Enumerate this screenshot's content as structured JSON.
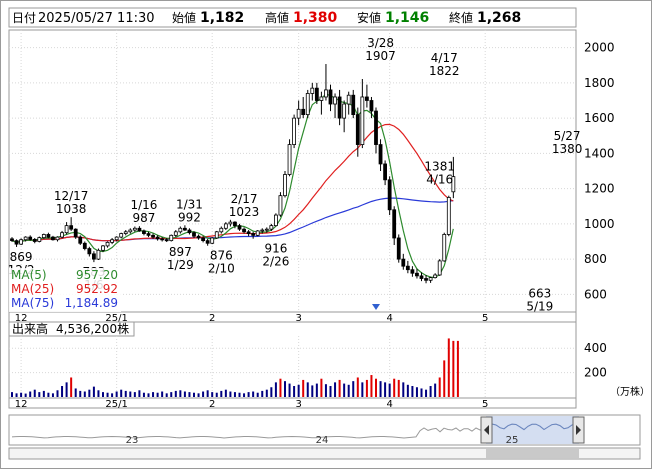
{
  "header": {
    "date_label": "日付",
    "date_value": "2025/05/27 11:30",
    "open_label": "始値",
    "open_value": "1,182",
    "high_label": "高値",
    "high_value": "1,380",
    "low_label": "安値",
    "low_value": "1,146",
    "close_label": "終値",
    "close_value": "1,268"
  },
  "colors": {
    "up": "#000080",
    "down": "#000000",
    "ma5": "#2e8b2e",
    "ma25": "#e02020",
    "ma75": "#2a3ad8",
    "high_value_text": "#e00000",
    "low_value_text": "#008000",
    "volume_normal": "#000080",
    "volume_high": "#e00000",
    "navigator_fill": "#b7c8e8"
  },
  "legend": {
    "ma5_label": "MA(5)",
    "ma5_value": "957.20",
    "ma25_label": "MA(25)",
    "ma25_value": "952.92",
    "ma75_label": "MA(75)",
    "ma75_value": "1,184.89"
  },
  "volume_panel": {
    "title": "出来高",
    "value": "4,536,200株",
    "unit": "（万株）"
  },
  "navigator": {
    "year_labels": [
      "23",
      "24",
      "25"
    ]
  },
  "chart_data": [
    {
      "type": "candlestick",
      "title": "",
      "ylim": [
        500,
        2100
      ],
      "y_ticks": [
        600,
        800,
        1000,
        1200,
        1400,
        1600,
        1800,
        2000
      ],
      "month_labels": [
        {
          "label": "12",
          "day": 2
        },
        {
          "label": "25/1",
          "day": 23
        },
        {
          "label": "2",
          "day": 44
        },
        {
          "label": "3",
          "day": 63
        },
        {
          "label": "4",
          "day": 83
        },
        {
          "label": "5",
          "day": 104
        }
      ],
      "annotations": [
        {
          "text": "869",
          "sub": "12/2",
          "day": 2,
          "value": 869,
          "pos": "below"
        },
        {
          "text": "12/17",
          "sub": "1038",
          "day": 13,
          "value": 1038,
          "pos": "above"
        },
        {
          "text": "783",
          "sub": "1/6",
          "day": 18,
          "value": 783,
          "pos": "below"
        },
        {
          "text": "1/16",
          "sub": "987",
          "day": 29,
          "value": 987,
          "pos": "above"
        },
        {
          "text": "897",
          "sub": "1/29",
          "day": 37,
          "value": 897,
          "pos": "below"
        },
        {
          "text": "1/31",
          "sub": "992",
          "day": 39,
          "value": 992,
          "pos": "above"
        },
        {
          "text": "876",
          "sub": "2/10",
          "day": 46,
          "value": 876,
          "pos": "below"
        },
        {
          "text": "2/17",
          "sub": "1023",
          "day": 51,
          "value": 1023,
          "pos": "above"
        },
        {
          "text": "916",
          "sub": "2/26",
          "day": 58,
          "value": 916,
          "pos": "below"
        },
        {
          "text": "3/28",
          "sub": "1907",
          "day": 81,
          "value": 1907,
          "pos": "above"
        },
        {
          "text": "4/17",
          "sub": "1822",
          "day": 95,
          "value": 1822,
          "pos": "above"
        },
        {
          "text": "1381",
          "sub": "4/16",
          "day": 94,
          "value": 1381,
          "pos": "below"
        },
        {
          "text": "663",
          "sub": "5/19",
          "day": 116,
          "value": 663,
          "pos": "below"
        },
        {
          "text": "5/27",
          "sub": "1380",
          "day": 122,
          "value": 1380,
          "pos": "above"
        }
      ],
      "candles": [
        [
          915,
          925,
          898,
          905
        ],
        [
          905,
          912,
          869,
          885
        ],
        [
          885,
          918,
          880,
          910
        ],
        [
          910,
          930,
          900,
          925
        ],
        [
          925,
          935,
          905,
          912
        ],
        [
          912,
          920,
          890,
          900
        ],
        [
          900,
          928,
          895,
          922
        ],
        [
          922,
          945,
          915,
          940
        ],
        [
          940,
          950,
          918,
          925
        ],
        [
          925,
          932,
          905,
          910
        ],
        [
          910,
          930,
          900,
          925
        ],
        [
          925,
          960,
          918,
          950
        ],
        [
          950,
          1010,
          940,
          990
        ],
        [
          990,
          1038,
          960,
          970
        ],
        [
          970,
          975,
          915,
          925
        ],
        [
          925,
          935,
          880,
          890
        ],
        [
          890,
          900,
          850,
          860
        ],
        [
          860,
          870,
          815,
          830
        ],
        [
          830,
          845,
          783,
          800
        ],
        [
          800,
          860,
          795,
          850
        ],
        [
          850,
          880,
          840,
          875
        ],
        [
          875,
          900,
          865,
          895
        ],
        [
          895,
          920,
          885,
          910
        ],
        [
          910,
          930,
          900,
          925
        ],
        [
          925,
          950,
          918,
          945
        ],
        [
          945,
          965,
          935,
          955
        ],
        [
          955,
          975,
          945,
          965
        ],
        [
          965,
          985,
          955,
          975
        ],
        [
          975,
          987,
          955,
          960
        ],
        [
          960,
          968,
          935,
          945
        ],
        [
          945,
          955,
          925,
          935
        ],
        [
          935,
          945,
          915,
          925
        ],
        [
          925,
          935,
          905,
          915
        ],
        [
          915,
          925,
          900,
          910
        ],
        [
          910,
          920,
          897,
          905
        ],
        [
          905,
          940,
          900,
          935
        ],
        [
          935,
          965,
          925,
          955
        ],
        [
          955,
          985,
          945,
          975
        ],
        [
          975,
          992,
          960,
          965
        ],
        [
          965,
          975,
          940,
          950
        ],
        [
          950,
          958,
          920,
          930
        ],
        [
          930,
          940,
          910,
          920
        ],
        [
          920,
          930,
          895,
          905
        ],
        [
          905,
          915,
          876,
          890
        ],
        [
          890,
          925,
          885,
          920
        ],
        [
          920,
          960,
          915,
          955
        ],
        [
          955,
          985,
          945,
          975
        ],
        [
          975,
          1010,
          965,
          1000
        ],
        [
          1000,
          1023,
          985,
          1010
        ],
        [
          1010,
          1015,
          975,
          990
        ],
        [
          990,
          1000,
          960,
          970
        ],
        [
          970,
          980,
          945,
          955
        ],
        [
          955,
          965,
          930,
          945
        ],
        [
          945,
          955,
          916,
          935
        ],
        [
          935,
          965,
          930,
          960
        ],
        [
          960,
          975,
          945,
          965
        ],
        [
          965,
          980,
          950,
          970
        ],
        [
          970,
          1000,
          960,
          990
        ],
        [
          990,
          1060,
          985,
          1050
        ],
        [
          1050,
          1180,
          1040,
          1160
        ],
        [
          1160,
          1300,
          1150,
          1280
        ],
        [
          1280,
          1480,
          1270,
          1450
        ],
        [
          1450,
          1620,
          1430,
          1600
        ],
        [
          1600,
          1700,
          1560,
          1650
        ],
        [
          1650,
          1720,
          1600,
          1620
        ],
        [
          1620,
          1760,
          1600,
          1740
        ],
        [
          1740,
          1800,
          1700,
          1770
        ],
        [
          1770,
          1800,
          1680,
          1700
        ],
        [
          1700,
          1750,
          1620,
          1720
        ],
        [
          1720,
          1907,
          1700,
          1760
        ],
        [
          1760,
          1790,
          1640,
          1680
        ],
        [
          1680,
          1740,
          1600,
          1720
        ],
        [
          1720,
          1760,
          1560,
          1600
        ],
        [
          1600,
          1700,
          1520,
          1680
        ],
        [
          1680,
          1750,
          1620,
          1730
        ],
        [
          1730,
          1760,
          1600,
          1620
        ],
        [
          1620,
          1660,
          1381,
          1450
        ],
        [
          1450,
          1822,
          1430,
          1720
        ],
        [
          1720,
          1790,
          1660,
          1700
        ],
        [
          1700,
          1720,
          1600,
          1640
        ],
        [
          1640,
          1660,
          1400,
          1450
        ],
        [
          1450,
          1480,
          1300,
          1340
        ],
        [
          1340,
          1360,
          1220,
          1250
        ],
        [
          1250,
          1270,
          1050,
          1080
        ],
        [
          1080,
          1100,
          880,
          920
        ],
        [
          920,
          940,
          780,
          800
        ],
        [
          800,
          830,
          740,
          760
        ],
        [
          760,
          790,
          720,
          740
        ],
        [
          740,
          760,
          700,
          720
        ],
        [
          720,
          745,
          690,
          705
        ],
        [
          705,
          725,
          675,
          690
        ],
        [
          690,
          710,
          663,
          680
        ],
        [
          680,
          700,
          665,
          695
        ],
        [
          695,
          720,
          690,
          710
        ],
        [
          710,
          800,
          705,
          790
        ],
        [
          790,
          950,
          785,
          940
        ],
        [
          940,
          1160,
          930,
          1150
        ],
        [
          1182,
          1380,
          1146,
          1268
        ]
      ]
    },
    {
      "type": "bar",
      "title": "出来高",
      "ylim": [
        0,
        500
      ],
      "y_ticks": [
        200,
        400
      ],
      "values": [
        40,
        30,
        35,
        28,
        45,
        60,
        40,
        50,
        35,
        30,
        55,
        90,
        120,
        160,
        70,
        50,
        45,
        60,
        85,
        55,
        40,
        35,
        30,
        45,
        60,
        50,
        45,
        40,
        55,
        35,
        30,
        40,
        35,
        45,
        30,
        40,
        50,
        55,
        45,
        40,
        35,
        30,
        45,
        55,
        40,
        35,
        50,
        60,
        45,
        40,
        35,
        30,
        40,
        45,
        35,
        50,
        60,
        80,
        120,
        150,
        130,
        110,
        90,
        100,
        140,
        120,
        95,
        110,
        150,
        105,
        90,
        120,
        140,
        110,
        100,
        130,
        160,
        120,
        140,
        180,
        150,
        130,
        120,
        110,
        150,
        140,
        120,
        100,
        90,
        80,
        70,
        60,
        90,
        110,
        160,
        300,
        480,
        460,
        460
      ],
      "highlight_threshold": 140
    }
  ]
}
